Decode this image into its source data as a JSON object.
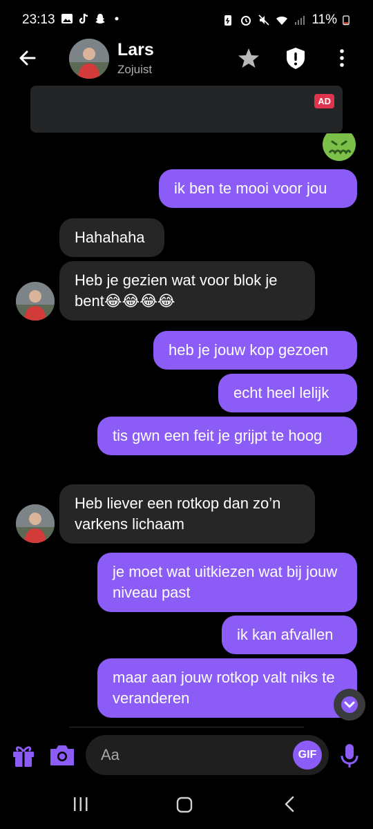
{
  "status_bar": {
    "time": "23:13",
    "battery": "11%"
  },
  "header": {
    "name": "Lars",
    "status": "Zojuist"
  },
  "ad": {
    "badge": "AD"
  },
  "messages": [
    {
      "dir": "out",
      "text": "ik ben te mooi voor jou"
    },
    {
      "dir": "in",
      "text": "Hahahaha"
    },
    {
      "dir": "in",
      "text": "Heb je gezien wat voor blok je bent😂😂😂😂"
    },
    {
      "dir": "out",
      "text": "heb je jouw kop gezoen"
    },
    {
      "dir": "out",
      "text": "echt heel lelijk"
    },
    {
      "dir": "out",
      "text": "tis gwn een feit je grijpt te hoog"
    },
    {
      "dir": "in",
      "text": "Heb liever een rotkop dan zo’n varkens lichaam"
    },
    {
      "dir": "out",
      "text": "je moet wat uitkiezen wat bij jouw niveau past"
    },
    {
      "dir": "out",
      "text": "ik kan afvallen"
    },
    {
      "dir": "out",
      "text": "maar aan jouw rotkop valt niks te veranderen"
    }
  ],
  "composer": {
    "placeholder": "Aa",
    "gif_label": "GIF"
  },
  "colors": {
    "accent": "#8b5cf6",
    "incoming": "#262627",
    "background": "#000000"
  },
  "icons": [
    "back-arrow-icon",
    "star-icon",
    "shield-alert-icon",
    "more-vertical-icon",
    "gift-icon",
    "camera-icon",
    "mic-icon",
    "chevron-down-icon"
  ]
}
